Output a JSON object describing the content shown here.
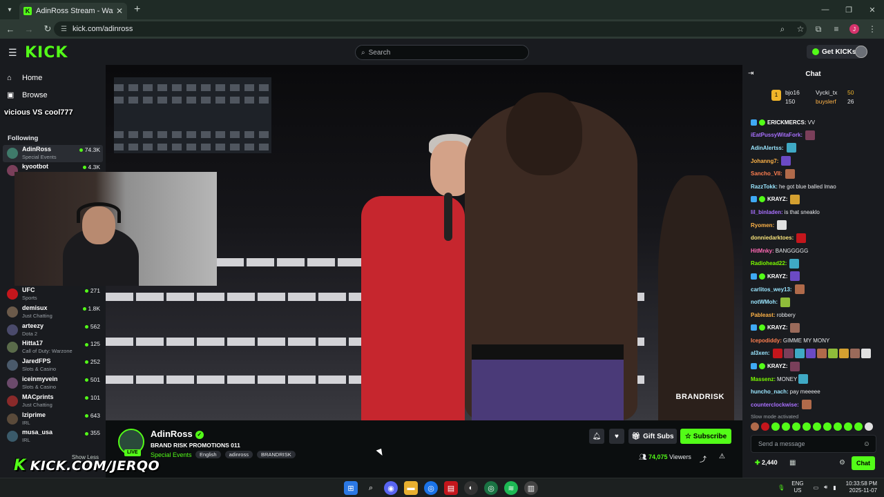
{
  "browser": {
    "tab_title": "AdinRoss Stream - Watch Live",
    "url": "kick.com/adinross"
  },
  "header": {
    "search_placeholder": "Search",
    "get_kicks": "Get KICKs",
    "logo": "KICK"
  },
  "sidebar": {
    "home": "Home",
    "browse": "Browse",
    "following_label": "Following",
    "followed_channels": [
      {
        "name": "AdinRoss",
        "category": "Special Events",
        "viewers": "74.3K",
        "color": "#3f7a6a"
      },
      {
        "name": "kyootbot",
        "category": "",
        "viewers": "4.3K",
        "color": "#7a3f5a"
      }
    ],
    "recommended_channels": [
      {
        "name": "UFC",
        "category": "Sports",
        "viewers": "271",
        "color": "#c4161c"
      },
      {
        "name": "demisux",
        "category": "Just Chatting",
        "viewers": "1.8K",
        "color": "#6b5a4a"
      },
      {
        "name": "arteezy",
        "category": "Dota 2",
        "viewers": "562",
        "color": "#4a4a6b"
      },
      {
        "name": "Hitta17",
        "category": "Call of Duty: Warzone",
        "viewers": "125",
        "color": "#5a6b4a"
      },
      {
        "name": "JaredFPS",
        "category": "Slots & Casino",
        "viewers": "252",
        "color": "#4a5a6b"
      },
      {
        "name": "iceinmyvein",
        "category": "Slots & Casino",
        "viewers": "501",
        "color": "#6b4a6b"
      },
      {
        "name": "MACprints",
        "category": "Just Chatting",
        "viewers": "101",
        "color": "#8a2a2a"
      },
      {
        "name": "lziprime",
        "category": "IRL",
        "viewers": "643",
        "color": "#5a4a3a"
      },
      {
        "name": "musa_usa",
        "category": "IRL",
        "viewers": "355",
        "color": "#3a5a6a"
      }
    ],
    "show_less": "Show Less"
  },
  "video": {
    "overlay_title": "vicious VS cool777",
    "watermark": "BRANDRISK",
    "brand_overlay": "KICK.COM/JERQO"
  },
  "stream": {
    "name": "AdinRoss",
    "live_badge": "LIVE",
    "title": "BRAND RISK PROMOTIONS 011",
    "category": "Special Events",
    "tags": [
      "English",
      "adinross",
      "BRANDRISK"
    ],
    "gift_subs": "Gift Subs",
    "subscribe": "Subscribe",
    "viewers": "74,075",
    "viewers_label": "Viewers"
  },
  "chat": {
    "title": "Chat",
    "gifters": [
      {
        "name": "bjo16",
        "count": "150"
      },
      {
        "name": "Vycki_tx",
        "count": "50"
      },
      {
        "name": "buyslerf",
        "count": "26"
      }
    ],
    "messages": [
      {
        "user": "ERICKMERCS",
        "color": "#ffffff",
        "text": "VV",
        "emotes": 0
      },
      {
        "user": "iEatPussyWitaFork",
        "color": "#a970ff",
        "text": "",
        "emotes": 1
      },
      {
        "user": "AdinAlertss",
        "color": "#9ae6ff",
        "text": "",
        "emotes": 1
      },
      {
        "user": "Johanng7",
        "color": "#ffb347",
        "text": "",
        "emotes": 1
      },
      {
        "user": "Sancho_VII",
        "color": "#ff7f50",
        "text": "",
        "emotes": 1
      },
      {
        "user": "RazzTokk",
        "color": "#9ae6ff",
        "text": "he got blue balled lmao",
        "emotes": 0
      },
      {
        "user": "KRAYZ",
        "color": "#ffffff",
        "text": "",
        "emotes": 1
      },
      {
        "user": "lil_binladen",
        "color": "#a970ff",
        "text": "is that sneaklo",
        "emotes": 0
      },
      {
        "user": "Ryomen",
        "color": "#ffb347",
        "text": "",
        "emotes": 1
      },
      {
        "user": "donniedarktoes",
        "color": "#f7e27a",
        "text": "",
        "emotes": 1
      },
      {
        "user": "HitMnky",
        "color": "#ff69b4",
        "text": "BANGGGGG",
        "emotes": 0
      },
      {
        "user": "Radiohead22",
        "color": "#7cfc00",
        "text": "",
        "emotes": 1
      },
      {
        "user": "KRAYZ",
        "color": "#ffffff",
        "text": "",
        "emotes": 1
      },
      {
        "user": "carlitos_wey13",
        "color": "#9ae6ff",
        "text": "",
        "emotes": 1
      },
      {
        "user": "notWMoh",
        "color": "#9ae6ff",
        "text": "",
        "emotes": 1
      },
      {
        "user": "Pableast",
        "color": "#ffb347",
        "text": "robbery",
        "emotes": 0
      },
      {
        "user": "KRAYZ",
        "color": "#ffffff",
        "text": "",
        "emotes": 1
      },
      {
        "user": "Icepodiddy",
        "color": "#ff7f50",
        "text": "GIMME MY MONY",
        "emotes": 0
      },
      {
        "user": "al3xen",
        "color": "#9ae6ff",
        "text": "",
        "emotes": 9
      },
      {
        "user": "KRAYZ",
        "color": "#ffffff",
        "text": "",
        "emotes": 1
      },
      {
        "user": "Massenz",
        "color": "#7cfc00",
        "text": "MONEY",
        "emotes": 1
      },
      {
        "user": "huncho_nach",
        "color": "#9ae6ff",
        "text": "pay meeeee",
        "emotes": 0
      },
      {
        "user": "counterclockwise",
        "color": "#a970ff",
        "text": "",
        "emotes": 1
      }
    ],
    "slow_mode": "Slow mode activated",
    "input_placeholder": "Send a message",
    "points": "2,440",
    "chat_button": "Chat"
  },
  "taskbar": {
    "lang": "ENG",
    "region": "US",
    "time": "10:33:58 PM",
    "date": "2025-11-07"
  }
}
